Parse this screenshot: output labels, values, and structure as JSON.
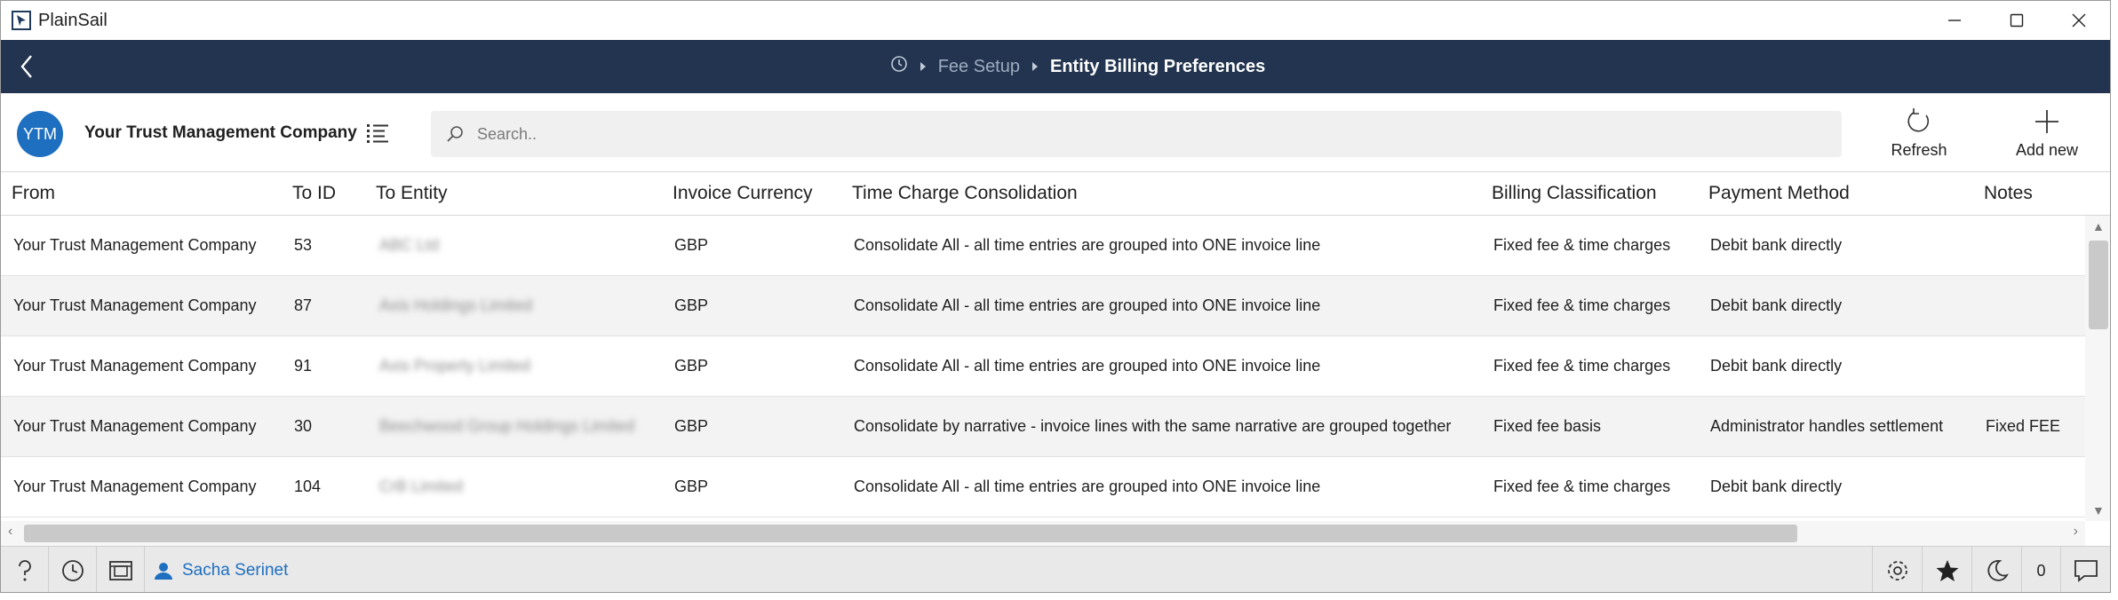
{
  "window": {
    "title": "PlainSail"
  },
  "nav": {
    "breadcrumb_link": "Fee Setup",
    "breadcrumb_current": "Entity Billing Preferences"
  },
  "toolbar": {
    "avatar_initials": "YTM",
    "company_name": "Your Trust Management Company",
    "search_placeholder": "Search..",
    "refresh_label": "Refresh",
    "add_new_label": "Add new"
  },
  "table": {
    "columns": [
      "From",
      "To ID",
      "To Entity",
      "Invoice Currency",
      "Time Charge Consolidation",
      "Billing Classification",
      "Payment Method",
      "Notes"
    ],
    "rows": [
      {
        "from": "Your Trust Management Company",
        "to_id": "53",
        "to_entity": "ABC Ltd",
        "currency": "GBP",
        "consolidation": "Consolidate All - all time entries are grouped into ONE invoice line",
        "classification": "Fixed fee & time charges",
        "payment": "Debit bank directly",
        "notes": ""
      },
      {
        "from": "Your Trust Management Company",
        "to_id": "87",
        "to_entity": "Axis Holdings Limited",
        "currency": "GBP",
        "consolidation": "Consolidate All - all time entries are grouped into ONE invoice line",
        "classification": "Fixed fee & time charges",
        "payment": "Debit bank directly",
        "notes": ""
      },
      {
        "from": "Your Trust Management Company",
        "to_id": "91",
        "to_entity": "Axis Property Limited",
        "currency": "GBP",
        "consolidation": "Consolidate All - all time entries are grouped into ONE invoice line",
        "classification": "Fixed fee & time charges",
        "payment": "Debit bank directly",
        "notes": ""
      },
      {
        "from": "Your Trust Management Company",
        "to_id": "30",
        "to_entity": "Beechwood Group Holdings Limited",
        "currency": "GBP",
        "consolidation": "Consolidate by narrative - invoice lines with the same narrative are grouped together",
        "classification": "Fixed fee basis",
        "payment": "Administrator handles settlement",
        "notes": "Fixed FEE"
      },
      {
        "from": "Your Trust Management Company",
        "to_id": "104",
        "to_entity": "CrB Limited",
        "currency": "GBP",
        "consolidation": "Consolidate All - all time entries are grouped into ONE invoice line",
        "classification": "Fixed fee & time charges",
        "payment": "Debit bank directly",
        "notes": ""
      }
    ]
  },
  "status": {
    "user_name": "Sacha Serinet",
    "notification_count": "0"
  },
  "colors": {
    "nav_bg": "#22344f",
    "accent": "#1e6fc0"
  }
}
